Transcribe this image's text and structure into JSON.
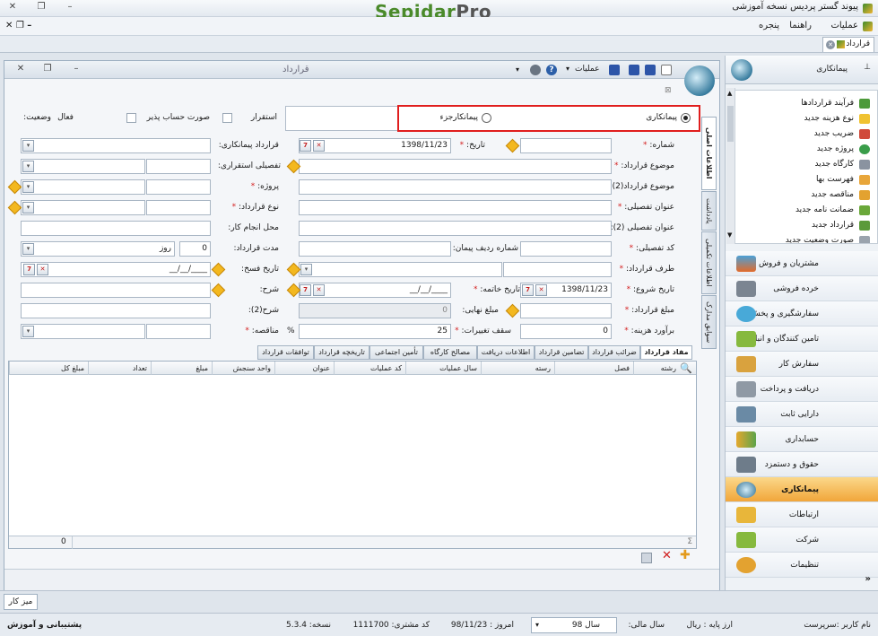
{
  "app": {
    "window_title": "پیوند گستر پردیس نسخه آموزشی",
    "logo_part1": "Sepidar",
    "logo_part2": "Pro",
    "menu": [
      "عملیات",
      "راهنما",
      "پنجره"
    ],
    "doc_tab": "قرارداد"
  },
  "form": {
    "title": "قرارداد",
    "toolbar_actions_label": "عملیات",
    "type_options": {
      "option1": "پیمانکاری",
      "option2": "پیمانکارجزء",
      "selected": "پیمانکاری"
    },
    "status_labels": {
      "status": "وضعیت:",
      "status_value": "فعال",
      "settlement": "استقرار",
      "billable": "صورت حساب پذیر"
    },
    "labels": {
      "number": "شماره:",
      "date": "تاریخ:",
      "contractor": "قرارداد پیمانکاری:",
      "subject": "موضوع قرارداد:",
      "detail_settlement": "تفصیلی استقراری:",
      "subject2": "موضوع قرارداد(2):",
      "project": "پروژه:",
      "detail_title": "عنوان تفصیلی:",
      "contract_type": "نوع قرارداد:",
      "detail_title2": "عنوان تفصیلی (2):",
      "work_place": "محل انجام کار:",
      "detail_code": "کد تفصیلی:",
      "contract_row": "شماره ردیف پیمان:",
      "duration": "مدت قرارداد:",
      "party": "طرف قرارداد:",
      "cancel_date": "تاریخ فسخ:",
      "start_date": "تاریخ شروع:",
      "end_date": "تاریخ خاتمه:",
      "description": "شرح:",
      "amount": "مبلغ قرارداد:",
      "final_amount": "مبلغ نهایی:",
      "description2": "شرح(2):",
      "estimate": "برآورد هزینه:",
      "change_cap": "سقف تغییرات:",
      "tender": "مناقصه:"
    },
    "values": {
      "date": "1398/11/23",
      "duration": "0",
      "duration_unit": "روز",
      "cancel_date": "__/__/____",
      "start_date": "1398/11/23",
      "end_date": "__/__/____",
      "final_amount": "0",
      "estimate": "0",
      "change_cap": "25",
      "change_cap_unit": "%"
    },
    "side_tabs": [
      "اطلاعات اصلی",
      "یادداشت",
      "اطلاعات تکمیلی",
      "سوابق مدارک"
    ],
    "bottom_tabs": [
      "مفاد قرارداد",
      "ضرائب قرارداد",
      "تضامین قرارداد",
      "اطلاعات دریافت",
      "مصالح کارگاه",
      "تأمین اجتماعی",
      "تاریخچه قرارداد",
      "توافقات قرارداد"
    ],
    "grid_columns": [
      "رشته",
      "فصل",
      "رسته",
      "سال عملیات",
      "کد عملیات",
      "عنوان",
      "واحد سنجش",
      "مبلغ",
      "تعداد",
      "مبلغ کل"
    ],
    "grid_total": "0"
  },
  "sidebar": {
    "title": "پیمانکاری",
    "quick_items": [
      "فرآیند قراردادها",
      "نوع هزینه جدید",
      "ضریب جدید",
      "پروژه جدید",
      "کارگاه جدید",
      "فهرست بها",
      "مناقصه جدید",
      "ضمانت نامه جدید",
      "قرارداد جدید",
      "صورت وضعیت جدید"
    ],
    "modules": [
      "مشتریان و فروش",
      "خرده فروشی",
      "سفارشگیری و پخش",
      "تامین کنندگان و انبار",
      "سفارش کار",
      "دریافت و پرداخت",
      "دارایی ثابت",
      "حسابداری",
      "حقوق و دستمزد",
      "پیمانکاری",
      "ارتباطات",
      "شرکت",
      "تنظیمات"
    ],
    "active_module": "پیمانکاری"
  },
  "taskbar": {
    "desk": "میز کار"
  },
  "status": {
    "user": "نام کاربر :سرپرست",
    "currency": "ارز پایه : ریال",
    "fiscal_label": "سال مالی:",
    "fiscal_value": "سال 98",
    "today": "امروز : 98/11/23",
    "customer_code": "کد مشتری: 1111700",
    "version": "نسخه: 5.3.4",
    "support": "پشتیبانی و آموزش"
  },
  "colors": {
    "accent": "#f1a63a",
    "highlight_border": "#e01e1e",
    "brand_green": "#4a8a2a"
  }
}
